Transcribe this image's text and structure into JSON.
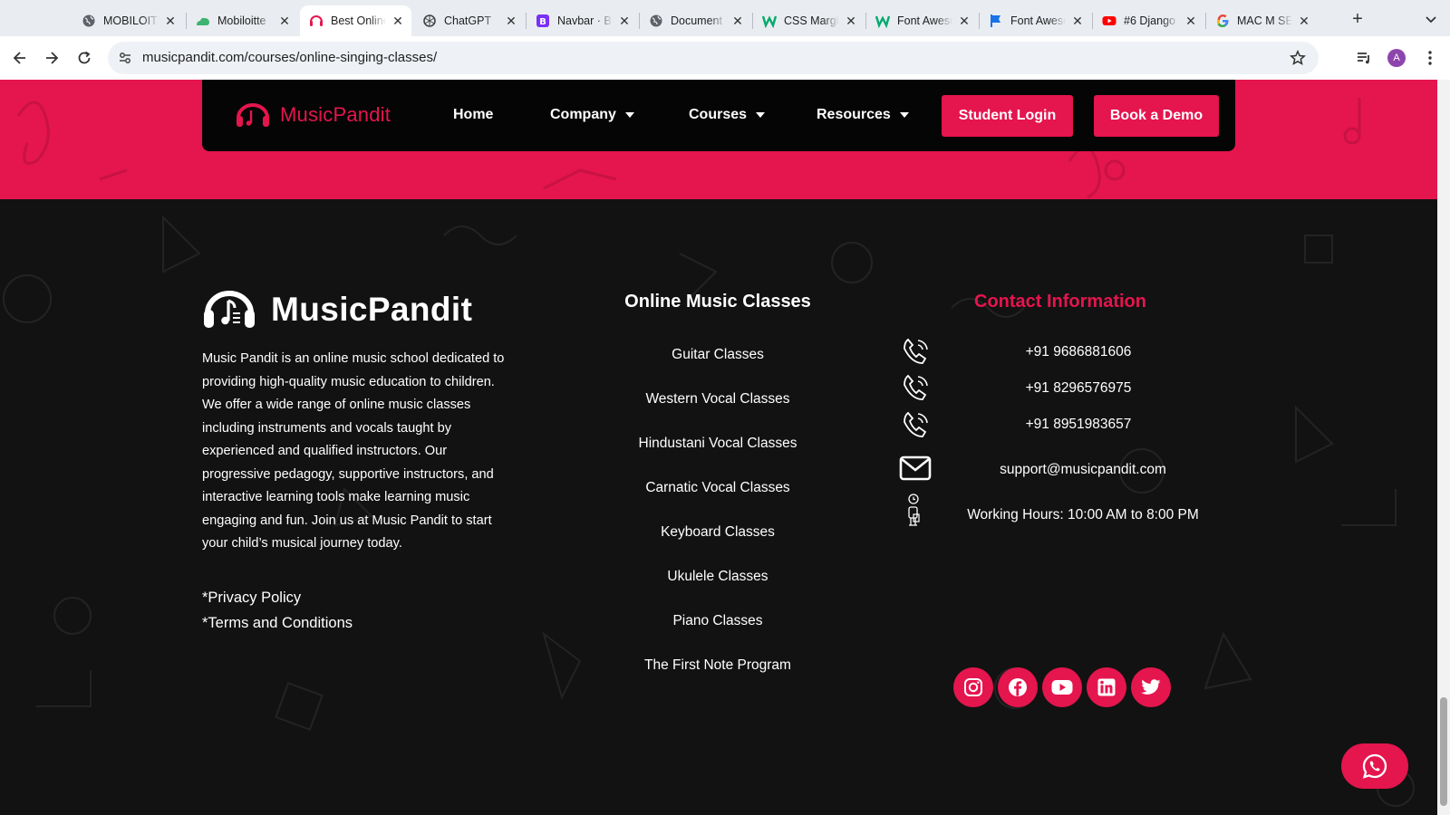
{
  "browser": {
    "tabs": [
      {
        "title": "MOBILOITTE",
        "icon": "globe-icon",
        "active": false
      },
      {
        "title": "Mobiloitte",
        "icon": "cloud-icon",
        "active": false
      },
      {
        "title": "Best Online",
        "icon": "headphones-icon",
        "active": true
      },
      {
        "title": "ChatGPT",
        "icon": "chatgpt-icon",
        "active": false
      },
      {
        "title": "Navbar · Bootstrap",
        "icon": "bootstrap-icon",
        "active": false
      },
      {
        "title": "Document",
        "icon": "globe-icon",
        "active": false
      },
      {
        "title": "CSS Margin",
        "icon": "w3schools-icon",
        "active": false
      },
      {
        "title": "Font Awesome",
        "icon": "w3schools-icon",
        "active": false
      },
      {
        "title": "Font Awesome",
        "icon": "flag-icon",
        "active": false
      },
      {
        "title": "#6 Django",
        "icon": "youtube-icon",
        "active": false
      },
      {
        "title": "MAC M SERIES",
        "icon": "google-icon",
        "active": false
      }
    ],
    "tab_close_glyph": "✕",
    "new_tab_glyph": "+",
    "url": "musicpandit.com/courses/online-singing-classes/",
    "avatar_letter": "A"
  },
  "navbar": {
    "logo_text": "MusicPandit",
    "items": [
      {
        "label": "Home",
        "dropdown": false
      },
      {
        "label": "Company",
        "dropdown": true
      },
      {
        "label": "Courses",
        "dropdown": true
      },
      {
        "label": "Resources",
        "dropdown": true
      }
    ],
    "student_login": "Student Login",
    "book_demo": "Book a Demo"
  },
  "footer": {
    "brand_text": "MusicPandit",
    "about": "Music Pandit is an online music school dedicated to providing high-quality music education to children. We offer a wide range of online music classes including instruments and vocals taught by experienced and qualified instructors. Our progressive pedagogy, supportive instructors, and interactive learning tools make learning music engaging and fun. Join us at Music Pandit to start your child’s musical journey today.",
    "legal_links": [
      "*Privacy Policy",
      "*Terms and Conditions"
    ],
    "courses_title": "Online Music Classes",
    "courses": [
      "Guitar Classes",
      "Western Vocal Classes",
      "Hindustani Vocal Classes",
      "Carnatic Vocal Classes",
      "Keyboard Classes",
      "Ukulele Classes",
      "Piano Classes",
      "The First Note Program"
    ],
    "contact_title": "Contact Information",
    "phones": [
      "+91 9686881606",
      "+91 8296576975",
      "+91 8951983657"
    ],
    "email": "support@musicpandit.com",
    "hours": "Working Hours: 10:00 AM to 8:00 PM",
    "socials": [
      "instagram-icon",
      "facebook-icon",
      "youtube-icon",
      "linkedin-icon",
      "twitter-icon"
    ]
  },
  "colors": {
    "brand_pink": "#e5154e",
    "footer_bg": "#121212",
    "navbar_bg": "#050505",
    "text_white": "#ffffff"
  }
}
